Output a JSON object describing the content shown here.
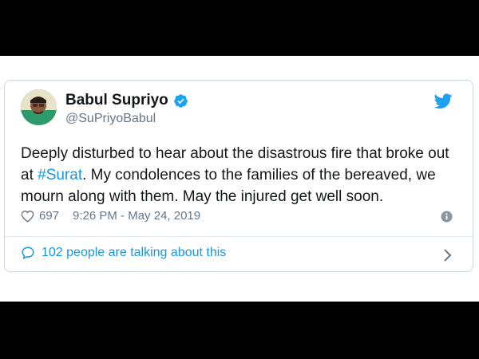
{
  "tweet": {
    "author_name": "Babul Supriyo",
    "handle": "@SuPriyoBabul",
    "text_parts": {
      "before": "Deeply disturbed to hear about the disastrous fire that broke out at ",
      "hashtag": "#Surat",
      "after": ". My condolences to the families of the bereaved, we mourn along with them. May the injured get well soon."
    },
    "likes": "697",
    "timestamp": "9:26 PM - May 24, 2019",
    "talking": "102 people are talking about this"
  },
  "colors": {
    "accent": "#1b95e0",
    "twitter_blue": "#1da1f2",
    "secondary_text": "#657786",
    "primary_text": "#14171a"
  },
  "icons": [
    "verified-badge-icon",
    "twitter-bird-icon",
    "heart-icon",
    "info-icon",
    "speech-bubble-icon",
    "chevron-right-icon"
  ]
}
